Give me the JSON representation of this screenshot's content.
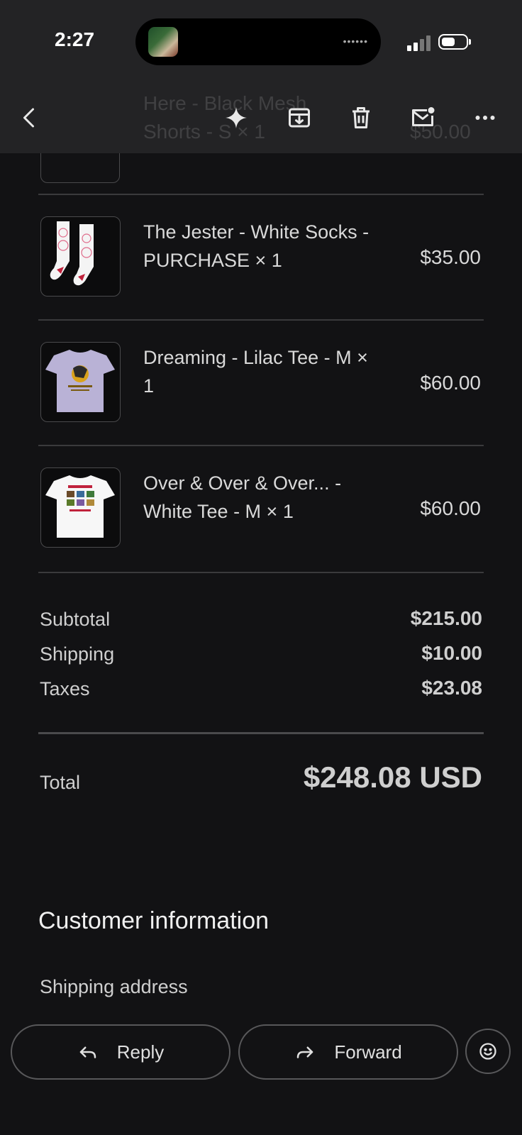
{
  "status_bar": {
    "time": "2:27"
  },
  "header": {
    "ghost_title_line1": "Here - Black Mesh",
    "ghost_title_line2": "Shorts - S × 1",
    "ghost_price": "$50.00"
  },
  "items": [
    {
      "title": "The Jester - White Socks - PURCHASE × 1",
      "price": "$35.00",
      "image": "white-socks"
    },
    {
      "title": "Dreaming - Lilac Tee - M × 1",
      "price": "$60.00",
      "image": "lilac-tee"
    },
    {
      "title": "Over & Over & Over... - White Tee - M × 1",
      "price": "$60.00",
      "image": "white-tee"
    }
  ],
  "summary": {
    "subtotal_label": "Subtotal",
    "subtotal": "$215.00",
    "shipping_label": "Shipping",
    "shipping": "$10.00",
    "taxes_label": "Taxes",
    "taxes": "$23.08",
    "total_label": "Total",
    "total": "$248.08 USD"
  },
  "customer": {
    "title": "Customer information",
    "shipping_address_label": "Shipping address"
  },
  "actions": {
    "reply": "Reply",
    "forward": "Forward"
  }
}
